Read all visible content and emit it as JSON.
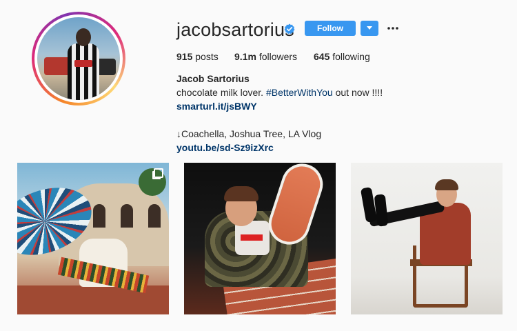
{
  "profile": {
    "username": "jacobsartorius",
    "verified": true,
    "follow_label": "Follow",
    "full_name": "Jacob Sartorius",
    "bio_text": "chocolate milk lover. ",
    "bio_hashtag": "#BetterWithYou",
    "bio_suffix": " out now !!!!",
    "link1": "smarturl.it/jsBWY",
    "bio_line2": "↓Coachella, Joshua Tree, LA Vlog",
    "link2": "youtu.be/sd-Sz9izXrc"
  },
  "stats": {
    "posts_count": "915",
    "posts_label": "posts",
    "followers_count": "9.1m",
    "followers_label": "followers",
    "following_count": "645",
    "following_label": "following"
  },
  "colors": {
    "accent": "#3897f0",
    "link": "#003569",
    "verified": "#3897f0"
  },
  "icons": [
    "verified-badge-icon",
    "chevron-down-icon",
    "more-options-icon",
    "multiple-images-icon"
  ]
}
